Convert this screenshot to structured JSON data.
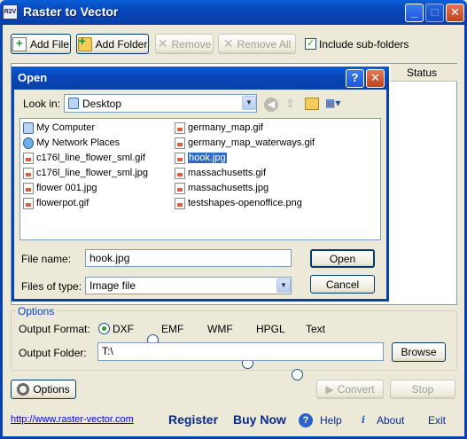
{
  "window": {
    "title": "Raster to Vector",
    "app_icon_text": "R2V",
    "minimize_glyph": "_",
    "maximize_glyph": "□",
    "close_glyph": "✕"
  },
  "toolbar": {
    "add_file_label": "Add File",
    "add_folder_label": "Add Folder",
    "remove_label": "Remove",
    "remove_all_label": "Remove All",
    "include_subfolders_label": "Include sub-folders",
    "include_subfolders_checked": true
  },
  "file_table": {
    "status_header": "Status"
  },
  "open_dialog": {
    "title": "Open",
    "help_glyph": "?",
    "close_glyph": "✕",
    "look_in_label": "Look in:",
    "look_in_value": "Desktop",
    "files": [
      {
        "name": "My Computer",
        "icon": "computer-icon"
      },
      {
        "name": "My Network Places",
        "icon": "network-places-icon"
      },
      {
        "name": "c176l_line_flower_sml.gif",
        "icon": "image-file-icon"
      },
      {
        "name": "c176l_line_flower_sml.jpg",
        "icon": "image-file-icon"
      },
      {
        "name": "flower 001.jpg",
        "icon": "image-file-icon"
      },
      {
        "name": "flowerpot.gif",
        "icon": "image-file-icon"
      },
      {
        "name": "germany_map.gif",
        "icon": "image-file-icon"
      },
      {
        "name": "germany_map_waterways.gif",
        "icon": "image-file-icon"
      },
      {
        "name": "hook.jpg",
        "icon": "image-file-icon",
        "selected": true
      },
      {
        "name": "massachusetts.gif",
        "icon": "image-file-icon"
      },
      {
        "name": "massachusetts.jpg",
        "icon": "image-file-icon"
      },
      {
        "name": "testshapes-openoffice.png",
        "icon": "image-file-icon"
      }
    ],
    "file_name_label": "File name:",
    "file_name_value": "hook.jpg",
    "files_of_type_label": "Files of type:",
    "files_of_type_value": "Image file",
    "open_button": "Open",
    "cancel_button": "Cancel"
  },
  "options": {
    "legend": "Options",
    "output_format_label": "Output Format:",
    "formats": [
      {
        "label": "DXF",
        "selected": true
      },
      {
        "label": "EMF",
        "selected": false
      },
      {
        "label": "WMF",
        "selected": false
      },
      {
        "label": "HPGL",
        "selected": false
      },
      {
        "label": "Text",
        "selected": false
      }
    ],
    "output_folder_label": "Output Folder:",
    "output_folder_value": "T:\\",
    "browse_button": "Browse"
  },
  "actions": {
    "options_button": "Options",
    "convert_button": "Convert",
    "stop_button": "Stop"
  },
  "footer": {
    "website": "http://www.raster-vector.com",
    "register": "Register",
    "buy_now": "Buy Now",
    "help": "Help",
    "about": "About",
    "exit": "Exit"
  }
}
